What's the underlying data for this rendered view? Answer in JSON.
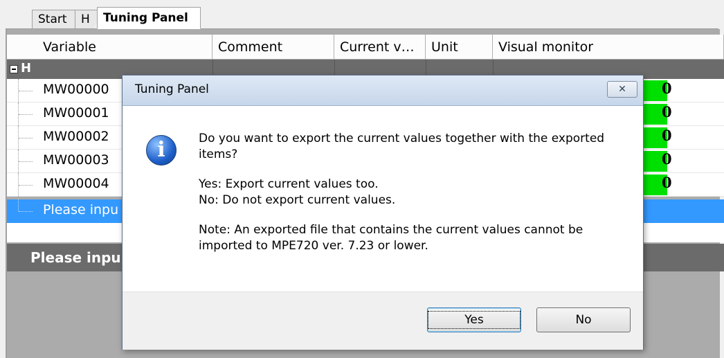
{
  "tabs": [
    {
      "label": "Start"
    },
    {
      "label": "H"
    },
    {
      "label": "Tuning Panel"
    }
  ],
  "grid": {
    "headers": {
      "variable": "Variable",
      "comment": "Comment",
      "current": "Current v…",
      "unit": "Unit",
      "visual": "Visual monitor"
    },
    "group_label": "H",
    "rows": [
      {
        "name": "MW00000",
        "value": "0"
      },
      {
        "name": "MW00001",
        "value": "0"
      },
      {
        "name": "MW00002",
        "value": "0"
      },
      {
        "name": "MW00003",
        "value": "0"
      },
      {
        "name": "MW00004",
        "value": "0"
      }
    ],
    "input_row": "Please inpu",
    "lower_bar": "Please inpu"
  },
  "dialog": {
    "title": "Tuning Panel",
    "close_glyph": "✕",
    "icon": "info-icon",
    "icon_glyph": "i",
    "line1": "Do you want to export the current values together with the exported",
    "line2": "items?",
    "line3": "Yes: Export current values too.",
    "line4": "No: Do not export current values.",
    "line5": "Note: An exported file that contains the current values cannot be",
    "line6": "imported to MPE720 ver. 7.23 or lower.",
    "yes_label": "Yes",
    "no_label": "No"
  },
  "colors": {
    "selection": "#3399ff",
    "monitor_bar": "#00e000",
    "group_row": "#6b6b6b"
  }
}
